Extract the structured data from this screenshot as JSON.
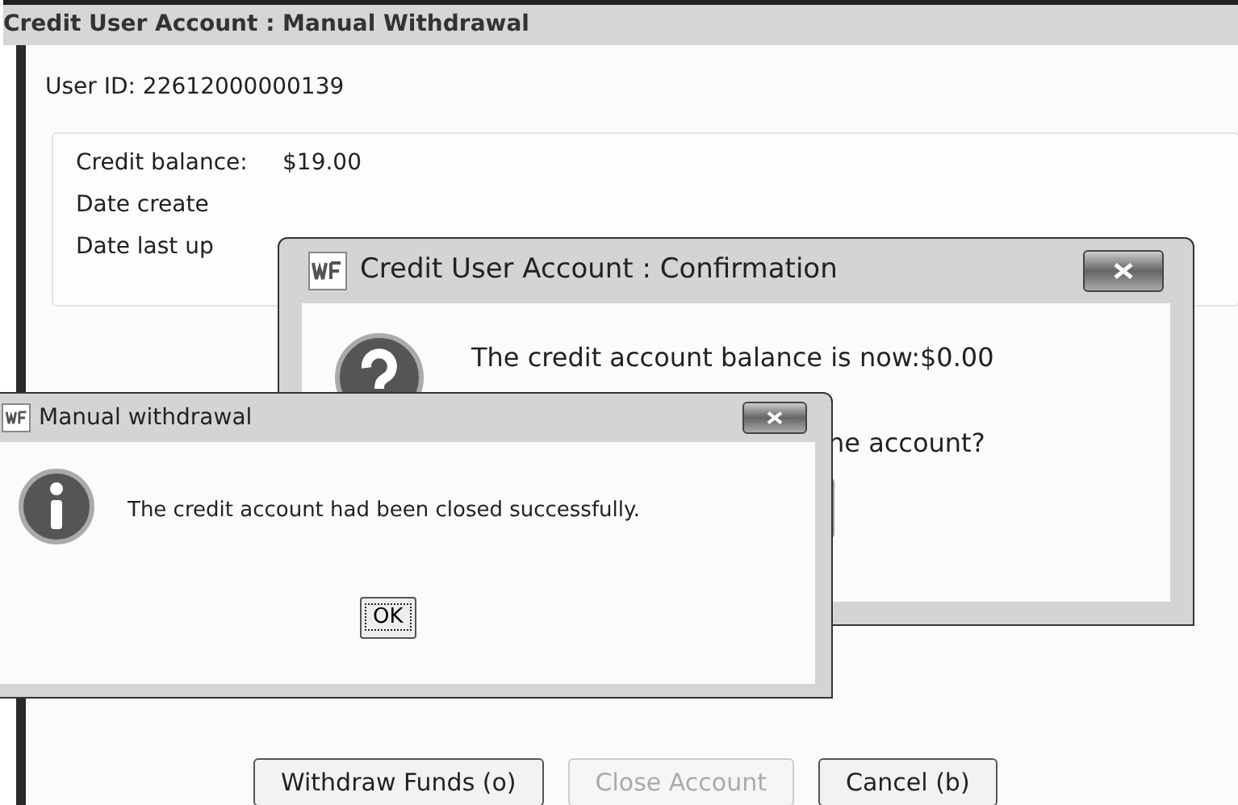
{
  "window": {
    "title": "Credit User Account : Manual Withdrawal"
  },
  "user_id": "User ID: 22612000000139",
  "details": [
    {
      "label": "Credit balance:",
      "value": "$19.00"
    },
    {
      "label": "Date create"
    },
    {
      "label": "Date last up"
    }
  ],
  "buttons": [
    {
      "label": "Withdraw Funds (o)",
      "disabled": false
    },
    {
      "label": "Close Account",
      "disabled": true
    },
    {
      "label": "Cancel (b)",
      "disabled": false
    }
  ],
  "confirmation": {
    "title": "Credit User Account : Confirmation",
    "message": "The credit account balance is now:$0.00",
    "question": "ne account?"
  },
  "info_dialog": {
    "title": "Manual withdrawal",
    "message": "The credit account had been closed successfully.",
    "button": "OK"
  }
}
